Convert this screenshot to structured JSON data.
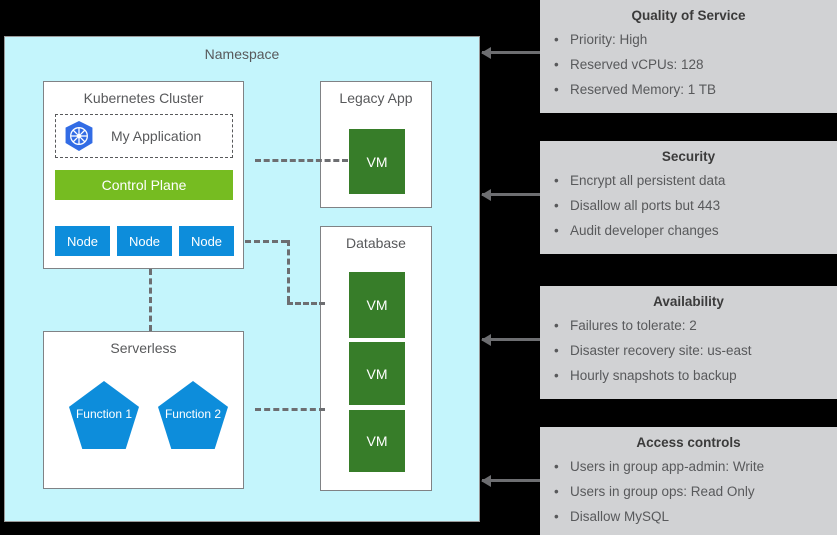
{
  "namespace": {
    "title": "Namespace",
    "clusters": {
      "kubernetes": {
        "title": "Kubernetes Cluster",
        "application": {
          "label": "My Application",
          "icon": "kubernetes-icon"
        },
        "control_plane": {
          "label": "Control Plane",
          "color": "#76bc21"
        },
        "nodes": [
          {
            "label": "Node"
          },
          {
            "label": "Node"
          },
          {
            "label": "Node"
          }
        ],
        "node_color": "#0d8ddb"
      },
      "serverless": {
        "title": "Serverless",
        "functions": [
          {
            "label": "Function 1"
          },
          {
            "label": "Function 2"
          }
        ],
        "function_color": "#0d8ddb"
      },
      "legacy_app": {
        "title": "Legacy App",
        "vms": [
          {
            "label": "VM"
          }
        ],
        "vm_color": "#377d29"
      },
      "database": {
        "title": "Database",
        "vms": [
          {
            "label": "VM"
          },
          {
            "label": "VM"
          },
          {
            "label": "VM"
          }
        ],
        "vm_color": "#377d29"
      }
    },
    "background_color": "#c4f5fc"
  },
  "panels": [
    {
      "title": "Quality of Service",
      "items": [
        "Priority: High",
        "Reserved vCPUs: 128",
        "Reserved Memory: 1 TB"
      ]
    },
    {
      "title": "Security",
      "items": [
        "Encrypt all persistent data",
        "Disallow all ports but 443",
        "Audit developer changes"
      ]
    },
    {
      "title": "Availability",
      "items": [
        "Failures to tolerate: 2",
        "Disaster recovery site: us-east",
        "Hourly snapshots to backup"
      ]
    },
    {
      "title": "Access controls",
      "items": [
        "Users in group app-admin: Write",
        "Users in group ops: Read Only",
        "Disallow MySQL"
      ]
    }
  ],
  "bullet_glyph": "•",
  "panel_color": "#d1d2d4",
  "connector_color": "#6d6e71"
}
